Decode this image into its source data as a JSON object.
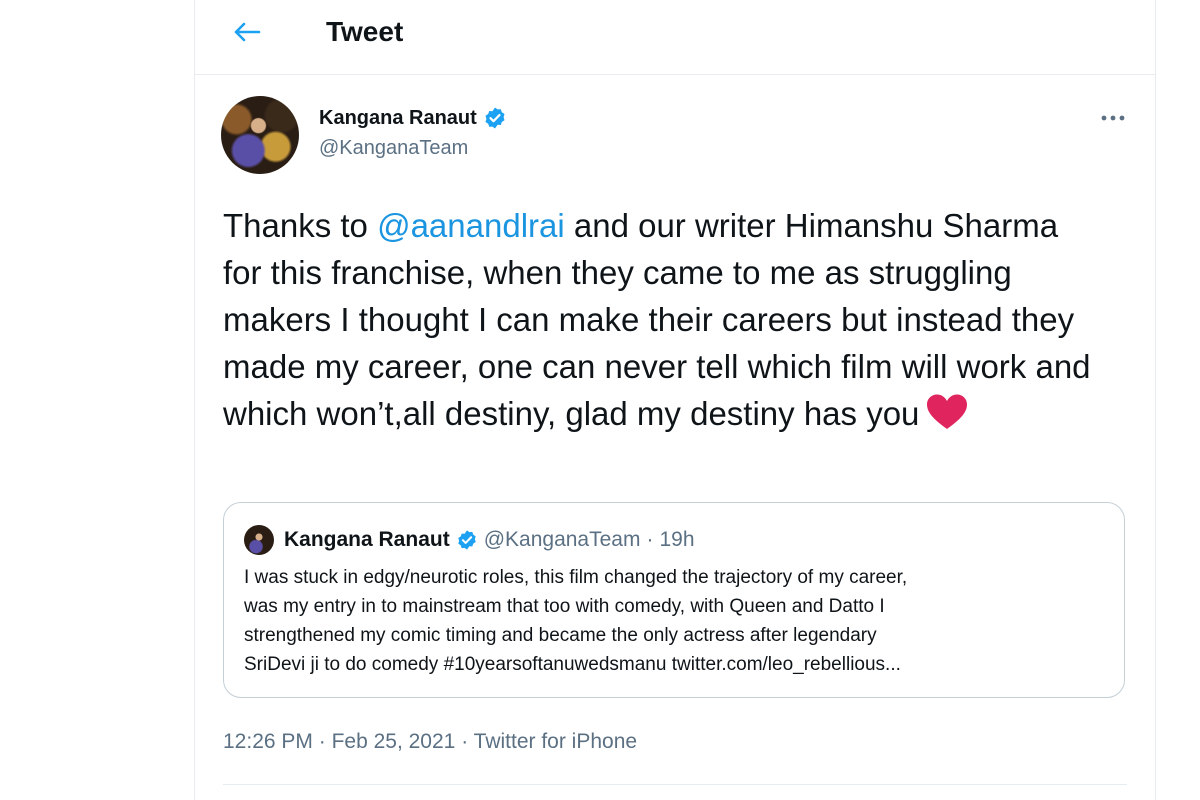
{
  "header": {
    "title": "Tweet"
  },
  "tweet": {
    "author": "Kangana Ranaut",
    "handle": "@KanganaTeam",
    "text_before": "Thanks to ",
    "mention": "@aanandlrai",
    "text_after": " and our writer Himanshu Sharma for this franchise, when they came to me as struggling makers I thought I can make their careers but instead they made my career, one can never tell which film will work and which won’t,all destiny, glad my destiny has you",
    "emoji": "heart-emoji",
    "time": "12:26 PM",
    "date": "Feb 25, 2021",
    "source": "Twitter for iPhone",
    "separator": "·"
  },
  "quoted": {
    "author": "Kangana Ranaut",
    "handle": "@KanganaTeam",
    "separator": "·",
    "time": "19h",
    "lines": [
      "I was stuck in edgy/neurotic roles, this film changed the trajectory of my career,",
      "was my entry in to mainstream that too with comedy, with Queen and Datto I",
      "strengthened my comic timing and became the only actress after legendary",
      "SriDevi ji to do comedy #10yearsoftanuwedsmanu twitter.com/leo_rebellious..."
    ]
  },
  "icons": {
    "back": "arrow-left-icon",
    "more": "more-horizontal-icon",
    "verified": "verified-badge-icon"
  },
  "colors": {
    "accent": "#1da1f2",
    "link": "#1b95e0",
    "secondary_text": "#5b7083",
    "heart": "#e0245e"
  }
}
